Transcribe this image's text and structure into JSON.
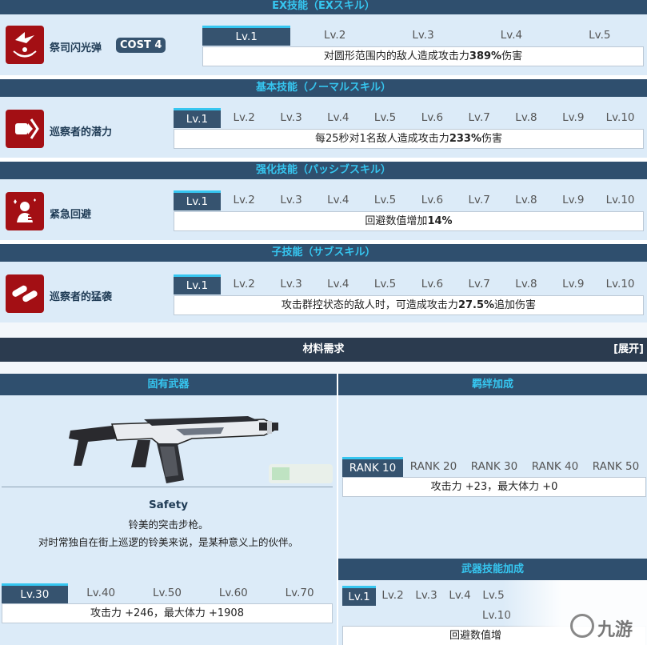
{
  "sections": {
    "ex": {
      "header": "EX技能（EXスキル）",
      "name": "祭司闪光弹",
      "cost": "COST 4",
      "tabs": [
        "Lv.1",
        "Lv.2",
        "Lv.3",
        "Lv.4",
        "Lv.5"
      ],
      "desc_pre": "对圆形范围内的敌人造成攻击力",
      "desc_value": "389%",
      "desc_post": "伤害",
      "icon": "target-burst-icon"
    },
    "basic": {
      "header": "基本技能（ノーマルスキル）",
      "name": "巡察者的潜力",
      "tabs": [
        "Lv.1",
        "Lv.2",
        "Lv.3",
        "Lv.4",
        "Lv.5",
        "Lv.6",
        "Lv.7",
        "Lv.8",
        "Lv.9",
        "Lv.10"
      ],
      "desc_pre": "每25秒对1名敌人造成攻击力",
      "desc_value": "233%",
      "desc_post": "伤害",
      "icon": "bullet-dash-icon"
    },
    "enhance": {
      "header": "强化技能（パッシブスキル）",
      "name": "紧急回避",
      "tabs": [
        "Lv.1",
        "Lv.2",
        "Lv.3",
        "Lv.4",
        "Lv.5",
        "Lv.6",
        "Lv.7",
        "Lv.8",
        "Lv.9",
        "Lv.10"
      ],
      "desc_pre": "回避数值增加",
      "desc_value": "14%",
      "desc_post": "",
      "icon": "dodge-person-icon"
    },
    "sub": {
      "header": "子技能（サブスキル）",
      "name": "巡察者的猛袭",
      "tabs": [
        "Lv.1",
        "Lv.2",
        "Lv.3",
        "Lv.4",
        "Lv.5",
        "Lv.6",
        "Lv.7",
        "Lv.8",
        "Lv.9",
        "Lv.10"
      ],
      "desc_pre": "攻击群控状态的敌人时，可造成攻击力",
      "desc_value": "27.5%",
      "desc_post": "追加伤害",
      "icon": "double-bullet-icon"
    }
  },
  "materials": {
    "title": "材料需求",
    "toggle": "[展开]"
  },
  "weapon": {
    "header": "固有武器",
    "name": "Safety",
    "line1": "铃美的突击步枪。",
    "line2": "对时常独自在街上巡逻的铃美来说，是某种意义上的伙伴。",
    "tabs": [
      "Lv.30",
      "Lv.40",
      "Lv.50",
      "Lv.60",
      "Lv.70"
    ],
    "stats": "攻击力 +246，最大体力 +1908",
    "image": "assault-rifle-image"
  },
  "bond": {
    "header": "羁绊加成",
    "tabs": [
      "RANK 10",
      "RANK 20",
      "RANK 30",
      "RANK 40",
      "RANK 50"
    ],
    "stats": "攻击力 +23，最大体力 +0"
  },
  "weapon_skill": {
    "header": "武器技能加成",
    "tabs": [
      "Lv.1",
      "Lv.2",
      "Lv.3",
      "Lv.4",
      "Lv.5"
    ],
    "extra_tab": "Lv.10",
    "desc": "回避数值增"
  },
  "watermark": "九游"
}
